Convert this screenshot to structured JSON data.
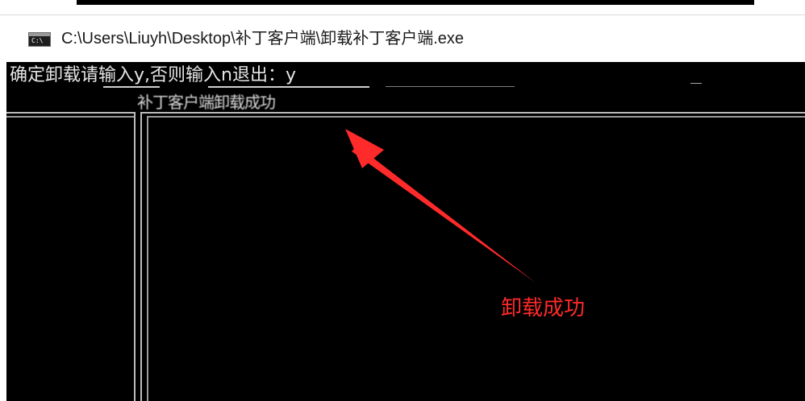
{
  "window": {
    "title": "C:\\Users\\Liuyh\\Desktop\\补丁客户端\\卸载补丁客户端.exe",
    "icon": "cmd-console-icon",
    "icon_glyph": "C:\\"
  },
  "console": {
    "prompt_line": "确定卸载请输入y,否则输入n退出：y",
    "result_line": "补丁客户端卸载成功"
  },
  "annotation": {
    "label": "卸载成功",
    "color": "#ff2a2a"
  },
  "colors": {
    "console_bg": "#000000",
    "console_text": "#e6e6e6",
    "titlebar_bg": "#ffffff"
  }
}
